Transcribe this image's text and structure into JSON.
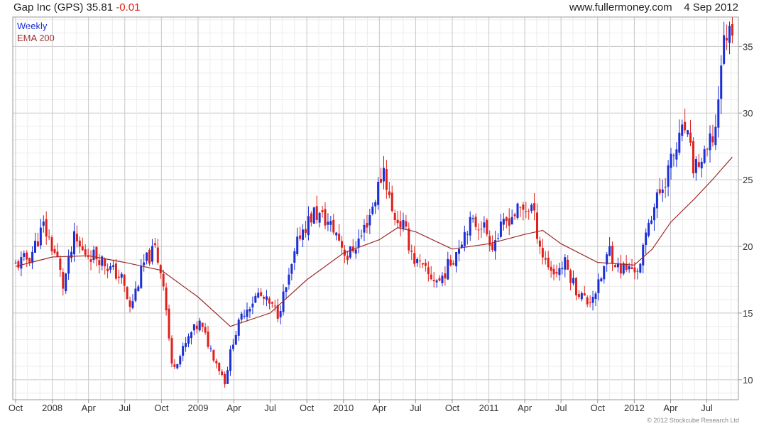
{
  "header": {
    "ticker": "Gap Inc (GPS)",
    "last": "35.81",
    "change": "-0.01",
    "site": "www.fullermoney.com",
    "date": "4 Sep 2012"
  },
  "legend": {
    "period": "Weekly",
    "ema": "EMA 200"
  },
  "footer": {
    "copyright": "© 2012 Stockcube Research Ltd"
  },
  "colors": {
    "up": "#1b2fd6",
    "down": "#e0201b",
    "ema": "#9a2b2b",
    "grid": "#d9d9d9"
  },
  "chart_data": {
    "type": "candlestick",
    "period": "weekly",
    "ylim": [
      8.5,
      37.2
    ],
    "yticks": [
      10,
      15,
      20,
      25,
      30,
      35
    ],
    "xlim": [
      "2007-10-01",
      "2012-09-04"
    ],
    "xticks": [
      {
        "label": "Oct",
        "date": "2007-10-01"
      },
      {
        "label": "2008",
        "date": "2008-01-01"
      },
      {
        "label": "Apr",
        "date": "2008-04-01"
      },
      {
        "label": "Jul",
        "date": "2008-07-01"
      },
      {
        "label": "Oct",
        "date": "2008-10-01"
      },
      {
        "label": "2009",
        "date": "2009-01-01"
      },
      {
        "label": "Apr",
        "date": "2009-04-01"
      },
      {
        "label": "Jul",
        "date": "2009-07-01"
      },
      {
        "label": "Oct",
        "date": "2009-10-01"
      },
      {
        "label": "2010",
        "date": "2010-01-01"
      },
      {
        "label": "Apr",
        "date": "2010-04-01"
      },
      {
        "label": "Jul",
        "date": "2010-07-01"
      },
      {
        "label": "Oct",
        "date": "2010-10-01"
      },
      {
        "label": "2011",
        "date": "2011-01-01"
      },
      {
        "label": "Apr",
        "date": "2011-04-01"
      },
      {
        "label": "Jul",
        "date": "2011-07-01"
      },
      {
        "label": "Oct",
        "date": "2011-10-01"
      },
      {
        "label": "2012",
        "date": "2012-01-01"
      },
      {
        "label": "Apr",
        "date": "2012-04-01"
      },
      {
        "label": "Jul",
        "date": "2012-07-01"
      }
    ],
    "price_path": [
      [
        "2007-10-01",
        18.6
      ],
      [
        "2007-11-05",
        19.2
      ],
      [
        "2007-12-10",
        21.5
      ],
      [
        "2008-01-14",
        19.0
      ],
      [
        "2008-01-28",
        17.0
      ],
      [
        "2008-02-25",
        20.5
      ],
      [
        "2008-03-17",
        19.6
      ],
      [
        "2008-04-28",
        19.2
      ],
      [
        "2008-05-26",
        18.3
      ],
      [
        "2008-06-23",
        17.6
      ],
      [
        "2008-07-14",
        15.3
      ],
      [
        "2008-08-18",
        18.7
      ],
      [
        "2008-09-15",
        19.8
      ],
      [
        "2008-10-06",
        17.4
      ],
      [
        "2008-10-27",
        11.0
      ],
      [
        "2008-11-17",
        11.8
      ],
      [
        "2008-12-15",
        13.5
      ],
      [
        "2009-01-05",
        14.2
      ],
      [
        "2009-02-09",
        11.8
      ],
      [
        "2009-03-09",
        9.9
      ],
      [
        "2009-03-30",
        13.0
      ],
      [
        "2009-04-27",
        15.2
      ],
      [
        "2009-06-01",
        16.4
      ],
      [
        "2009-06-29",
        15.6
      ],
      [
        "2009-07-20",
        15.0
      ],
      [
        "2009-08-17",
        17.5
      ],
      [
        "2009-09-14",
        21.0
      ],
      [
        "2009-10-19",
        22.5
      ],
      [
        "2009-11-16",
        22.0
      ],
      [
        "2009-12-14",
        21.0
      ],
      [
        "2010-01-11",
        19.2
      ],
      [
        "2010-02-15",
        20.8
      ],
      [
        "2010-03-15",
        23.0
      ],
      [
        "2010-04-12",
        25.9
      ],
      [
        "2010-05-03",
        22.5
      ],
      [
        "2010-05-31",
        21.5
      ],
      [
        "2010-06-28",
        19.0
      ],
      [
        "2010-08-02",
        17.8
      ],
      [
        "2010-08-30",
        17.4
      ],
      [
        "2010-10-04",
        19.2
      ],
      [
        "2010-11-08",
        21.6
      ],
      [
        "2010-12-13",
        21.8
      ],
      [
        "2011-01-10",
        20.2
      ],
      [
        "2011-02-21",
        22.2
      ],
      [
        "2011-03-14",
        22.6
      ],
      [
        "2011-04-18",
        23.0
      ],
      [
        "2011-05-16",
        19.3
      ],
      [
        "2011-06-13",
        18.0
      ],
      [
        "2011-07-11",
        18.7
      ],
      [
        "2011-08-08",
        16.8
      ],
      [
        "2011-09-05",
        15.8
      ],
      [
        "2011-10-03",
        17.0
      ],
      [
        "2011-10-31",
        19.8
      ],
      [
        "2011-11-21",
        18.4
      ],
      [
        "2011-12-19",
        18.3
      ],
      [
        "2012-01-16",
        18.4
      ],
      [
        "2012-02-06",
        22.0
      ],
      [
        "2012-03-05",
        24.0
      ],
      [
        "2012-04-02",
        26.3
      ],
      [
        "2012-05-07",
        28.9
      ],
      [
        "2012-05-28",
        26.0
      ],
      [
        "2012-06-25",
        26.5
      ],
      [
        "2012-07-23",
        28.8
      ],
      [
        "2012-08-06",
        34.0
      ],
      [
        "2012-08-20",
        36.2
      ],
      [
        "2012-09-03",
        35.81
      ]
    ],
    "ema_path": [
      [
        "2007-10-01",
        18.5
      ],
      [
        "2008-01-01",
        19.2
      ],
      [
        "2008-04-01",
        19.3
      ],
      [
        "2008-07-01",
        18.8
      ],
      [
        "2008-10-01",
        18.2
      ],
      [
        "2009-01-01",
        16.2
      ],
      [
        "2009-03-23",
        14.0
      ],
      [
        "2009-07-01",
        15.0
      ],
      [
        "2009-10-01",
        17.5
      ],
      [
        "2010-01-01",
        19.5
      ],
      [
        "2010-04-01",
        20.5
      ],
      [
        "2010-05-17",
        21.4
      ],
      [
        "2010-07-01",
        21.1
      ],
      [
        "2010-10-01",
        19.8
      ],
      [
        "2011-01-01",
        20.2
      ],
      [
        "2011-04-01",
        20.9
      ],
      [
        "2011-05-16",
        21.2
      ],
      [
        "2011-07-01",
        20.2
      ],
      [
        "2011-10-01",
        18.8
      ],
      [
        "2012-01-01",
        18.6
      ],
      [
        "2012-02-15",
        19.8
      ],
      [
        "2012-04-01",
        21.8
      ],
      [
        "2012-06-01",
        23.6
      ],
      [
        "2012-07-15",
        25.0
      ],
      [
        "2012-09-03",
        26.7
      ]
    ]
  }
}
